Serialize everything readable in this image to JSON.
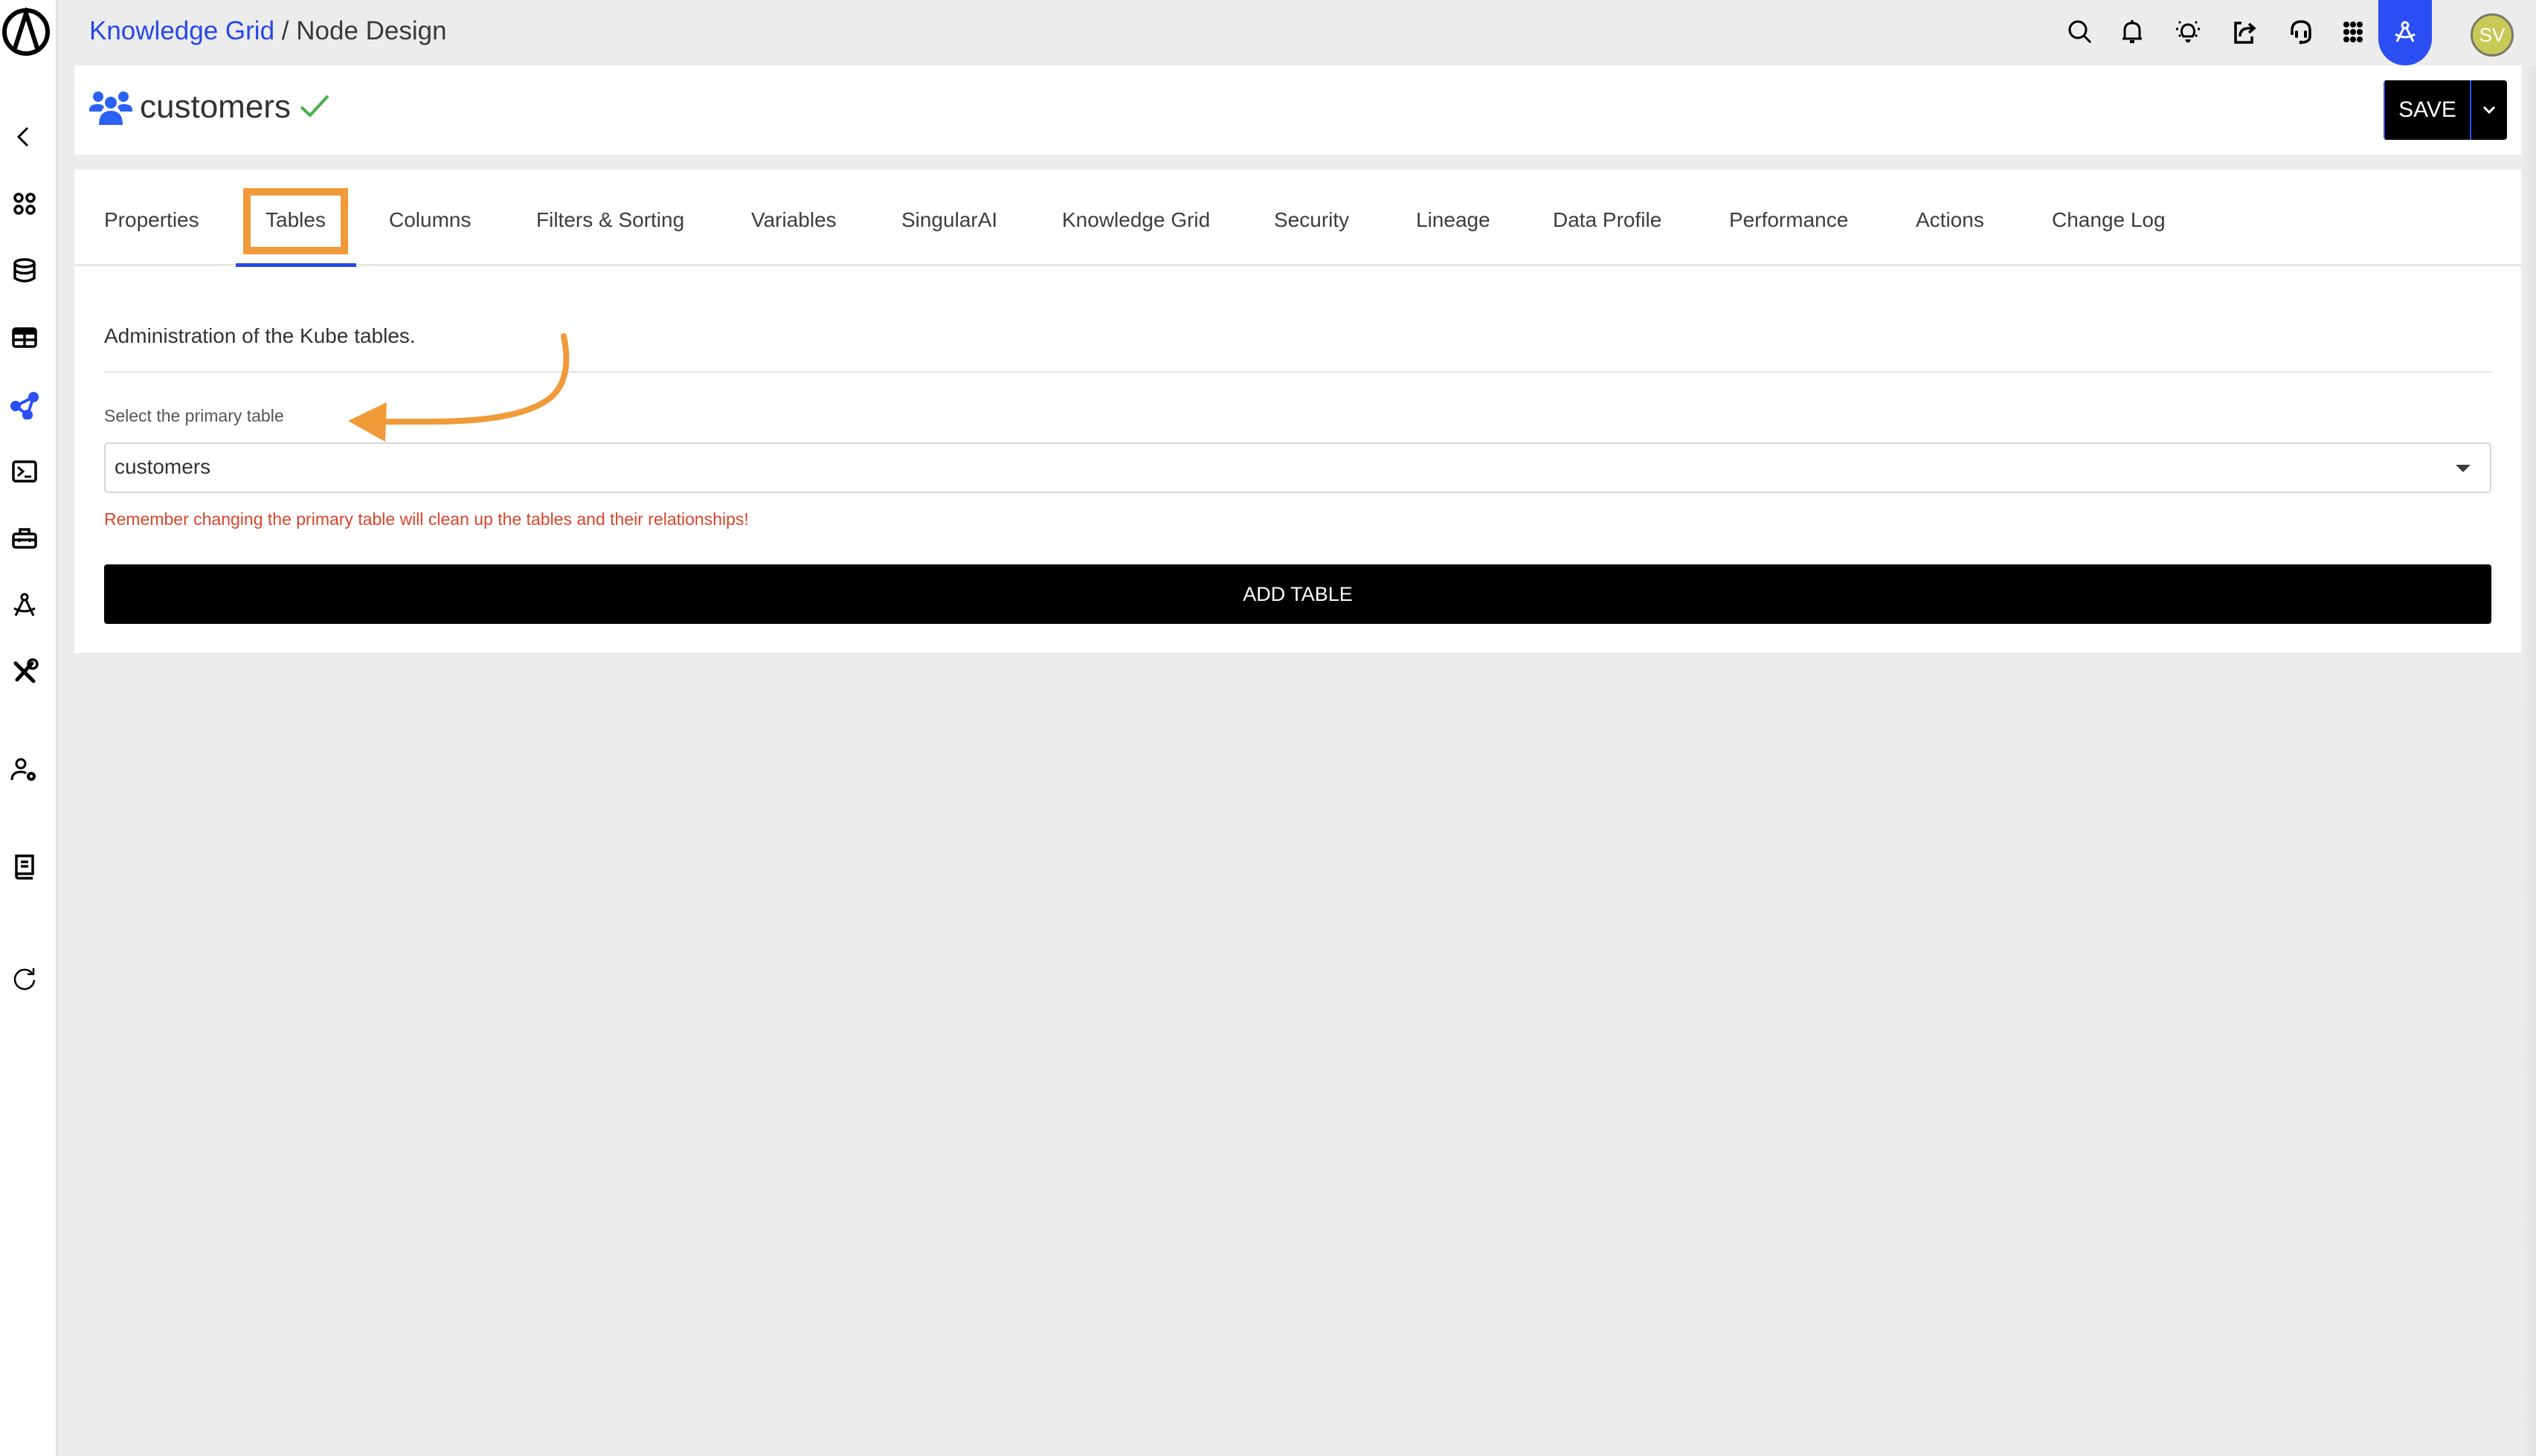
{
  "sidebar": {
    "items": [
      {
        "icon": "back-chevron-icon"
      },
      {
        "icon": "apps-grid-icon"
      },
      {
        "icon": "database-icon"
      },
      {
        "icon": "table-icon"
      },
      {
        "icon": "knowledge-graph-icon",
        "active": true
      },
      {
        "icon": "terminal-icon"
      },
      {
        "icon": "toolbox-icon"
      },
      {
        "icon": "compass-design-icon"
      },
      {
        "icon": "tools-icon"
      },
      {
        "icon": "user-settings-icon"
      },
      {
        "icon": "book-icon"
      },
      {
        "icon": "refresh-icon"
      }
    ]
  },
  "topbar": {
    "breadcrumb_link": "Knowledge Grid",
    "breadcrumb_sep": " / ",
    "breadcrumb_current": "Node Design",
    "icons": [
      "search-icon",
      "bell-icon",
      "lightbulb-icon",
      "share-icon",
      "headset-icon",
      "apps-icon",
      "design-mode-icon"
    ],
    "avatar_initials": "SV"
  },
  "header": {
    "node_name": "customers",
    "status": "valid",
    "save_label": "SAVE"
  },
  "tabs": [
    {
      "label": "Properties"
    },
    {
      "label": "Tables",
      "active": true
    },
    {
      "label": "Columns"
    },
    {
      "label": "Filters & Sorting"
    },
    {
      "label": "Variables"
    },
    {
      "label": "SingularAI"
    },
    {
      "label": "Knowledge Grid"
    },
    {
      "label": "Security"
    },
    {
      "label": "Lineage"
    },
    {
      "label": "Data Profile"
    },
    {
      "label": "Performance"
    },
    {
      "label": "Actions"
    },
    {
      "label": "Change Log"
    }
  ],
  "tables_panel": {
    "description": "Administration of the Kube tables.",
    "primary_table_label": "Select the primary table",
    "primary_table_value": "customers",
    "warning": "Remember changing the primary table will clean up the tables and their relationships!",
    "add_table_label": "ADD TABLE"
  },
  "colors": {
    "accent": "#2547e8",
    "annotation": "#f09a3a",
    "warning": "#d9452b",
    "success": "#4caf50",
    "avatar": "#c8c957"
  }
}
